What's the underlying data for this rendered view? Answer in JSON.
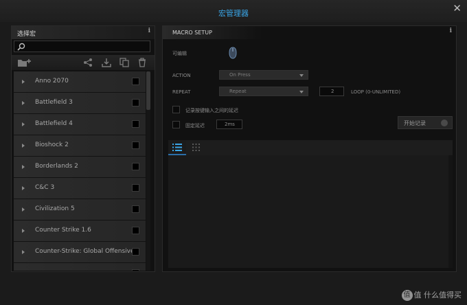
{
  "window": {
    "title": "宏管理器",
    "close_icon": "close-icon"
  },
  "left_panel": {
    "title": "选择宏",
    "info_label": "i",
    "search": {
      "value": "",
      "placeholder": ""
    },
    "toolbar_icons": [
      "new-folder-icon",
      "share-icon",
      "download-icon",
      "copy-icon",
      "trash-icon"
    ],
    "items": [
      {
        "label": "Anno 2070"
      },
      {
        "label": "Battlefield 3"
      },
      {
        "label": "Battlefield 4"
      },
      {
        "label": "Bioshock 2"
      },
      {
        "label": "Borderlands 2"
      },
      {
        "label": "C&C 3"
      },
      {
        "label": "Civilization 5"
      },
      {
        "label": "Counter Strike 1.6"
      },
      {
        "label": "Counter-Strike: Global Offensive"
      }
    ]
  },
  "macro_setup": {
    "title": "MACRO SETUP",
    "info_label": "i",
    "device_label": "可编辑",
    "action_label": "ACTION",
    "action_value": "On Press",
    "repeat_label": "REPEAT",
    "repeat_value": "Repeat",
    "repeat_count": "2",
    "loop_label": "LOOP (0-UNLIMITED)",
    "record_delay_label": "记录按键输入之间的延迟",
    "fixed_delay_label": "固定延迟",
    "fixed_delay_value": "2ms",
    "record_button_label": "开始记录"
  },
  "editor": {
    "tabs": [
      "list-view-icon",
      "grid-view-icon"
    ]
  },
  "watermark": {
    "text": "值 什么值得买",
    "badge": "值"
  },
  "colors": {
    "accent": "#3aa6e8",
    "background": "#1b1b1b",
    "panel": "#111111"
  }
}
